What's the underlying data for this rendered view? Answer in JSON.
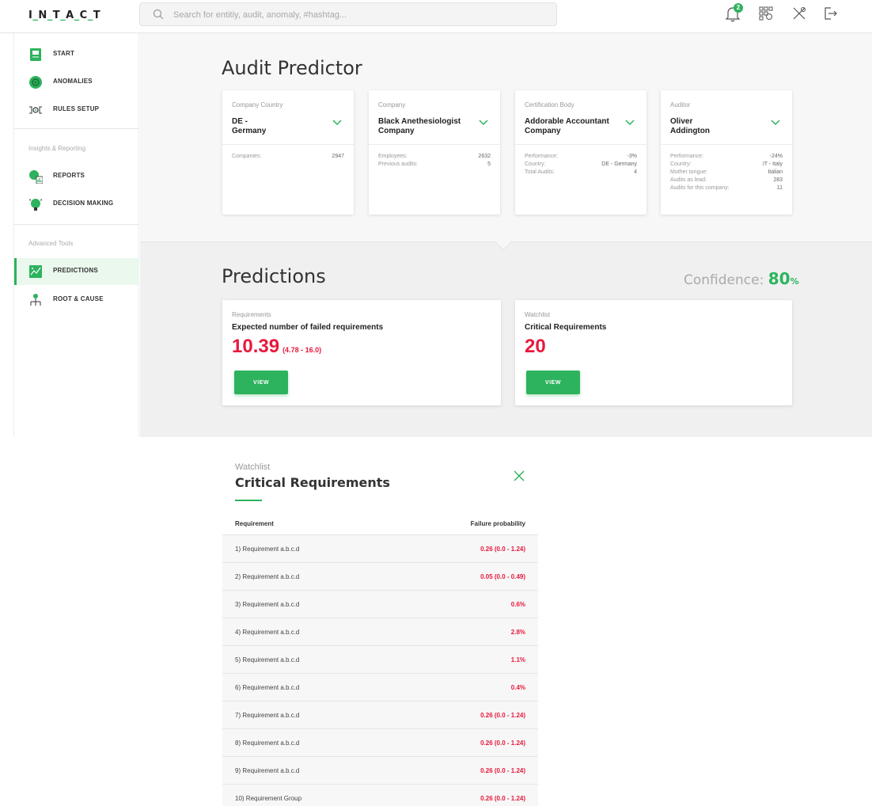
{
  "app": {
    "logo": "I_N_T_A_C_T",
    "search_placeholder": "Search for entitiy, audit, anomaly, #hashtag...",
    "notification_count": "2"
  },
  "sidebar": {
    "items_top": [
      {
        "label": "START",
        "icon": "start-icon"
      },
      {
        "label": "ANOMALIES",
        "icon": "anomalies-icon"
      },
      {
        "label": "RULES SETUP",
        "icon": "rules-setup-icon"
      }
    ],
    "section_insights": "Insights & Reporting",
    "items_insights": [
      {
        "label": "REPORTS",
        "icon": "reports-icon"
      },
      {
        "label": "DECISION MAKING",
        "icon": "decision-making-icon"
      }
    ],
    "section_advanced": "Advanced Tools",
    "items_advanced": [
      {
        "label": "PREDICTIONS",
        "icon": "predictions-icon",
        "active": true
      },
      {
        "label": "ROOT & CAUSE",
        "icon": "root-cause-icon"
      }
    ]
  },
  "audit_predictor": {
    "title": "Audit Predictor",
    "cards": [
      {
        "caption": "Company Country",
        "value": "DE -\nGermany",
        "stats": [
          {
            "label": "Companies:",
            "value": "2947"
          }
        ]
      },
      {
        "caption": "Company",
        "value": "Black Anethesiologist Company",
        "stats": [
          {
            "label": "Employees:",
            "value": "2632"
          },
          {
            "label": "Previous audits:",
            "value": "5"
          }
        ]
      },
      {
        "caption": "Certification Body",
        "value": "Addorable Accountant Company",
        "stats": [
          {
            "label": "Performance:",
            "value": "-3%"
          },
          {
            "label": "Country:",
            "value": "DE - Germany"
          },
          {
            "label": "Total Audits:",
            "value": "4"
          }
        ]
      },
      {
        "caption": "Auditor",
        "value": "Oliver Addington",
        "stats": [
          {
            "label": "Performance:",
            "value": "-24%"
          },
          {
            "label": "Country:",
            "value": "IT - Italy"
          },
          {
            "label": "Mother tongue:",
            "value": "Italian"
          },
          {
            "label": "Audits as lead:",
            "value": "283"
          },
          {
            "label": "Audits for this company:",
            "value": "11"
          }
        ]
      }
    ]
  },
  "predictions": {
    "title": "Predictions",
    "confidence_label": "Confidence:",
    "confidence_value": "80",
    "confidence_unit": "%",
    "cards": [
      {
        "caption": "Requirements",
        "title": "Expected number of failed requirements",
        "value": "10.39",
        "range": "(4.78 - 16.0)",
        "button": "VIEW"
      },
      {
        "caption": "Watchlist",
        "title": "Critical Requirements",
        "value": "20",
        "range": "",
        "button": "VIEW"
      }
    ]
  },
  "watchlist_modal": {
    "caption": "Watchlist",
    "title": "Critical Requirements",
    "columns": [
      "Requirement",
      "Failure probability"
    ],
    "rows": [
      {
        "requirement": "1) Requirement a.b.c.d",
        "probability": "0.26 (0.0 - 1.24)"
      },
      {
        "requirement": "2) Requirement a.b.c.d",
        "probability": "0.05 (0.0 - 0.49)"
      },
      {
        "requirement": "3) Requirement a.b.c.d",
        "probability": "0.6%"
      },
      {
        "requirement": "4) Requirement a.b.c.d",
        "probability": "2.8%"
      },
      {
        "requirement": "5) Requirement a.b.c.d",
        "probability": "1.1%"
      },
      {
        "requirement": "6) Requirement a.b.c.d",
        "probability": "0.4%"
      },
      {
        "requirement": "7) Requirement a.b.c.d",
        "probability": "0.26 (0.0 - 1.24)"
      },
      {
        "requirement": "8) Requirement a.b.c.d",
        "probability": "0.26 (0.0 - 1.24)"
      },
      {
        "requirement": "9) Requirement a.b.c.d",
        "probability": "0.26 (0.0 - 1.24)"
      },
      {
        "requirement": "10) Requirement Group",
        "probability": "0.26 (0.0 - 1.24)"
      }
    ]
  },
  "colors": {
    "accent": "#2db35d",
    "danger": "#e8193c"
  }
}
